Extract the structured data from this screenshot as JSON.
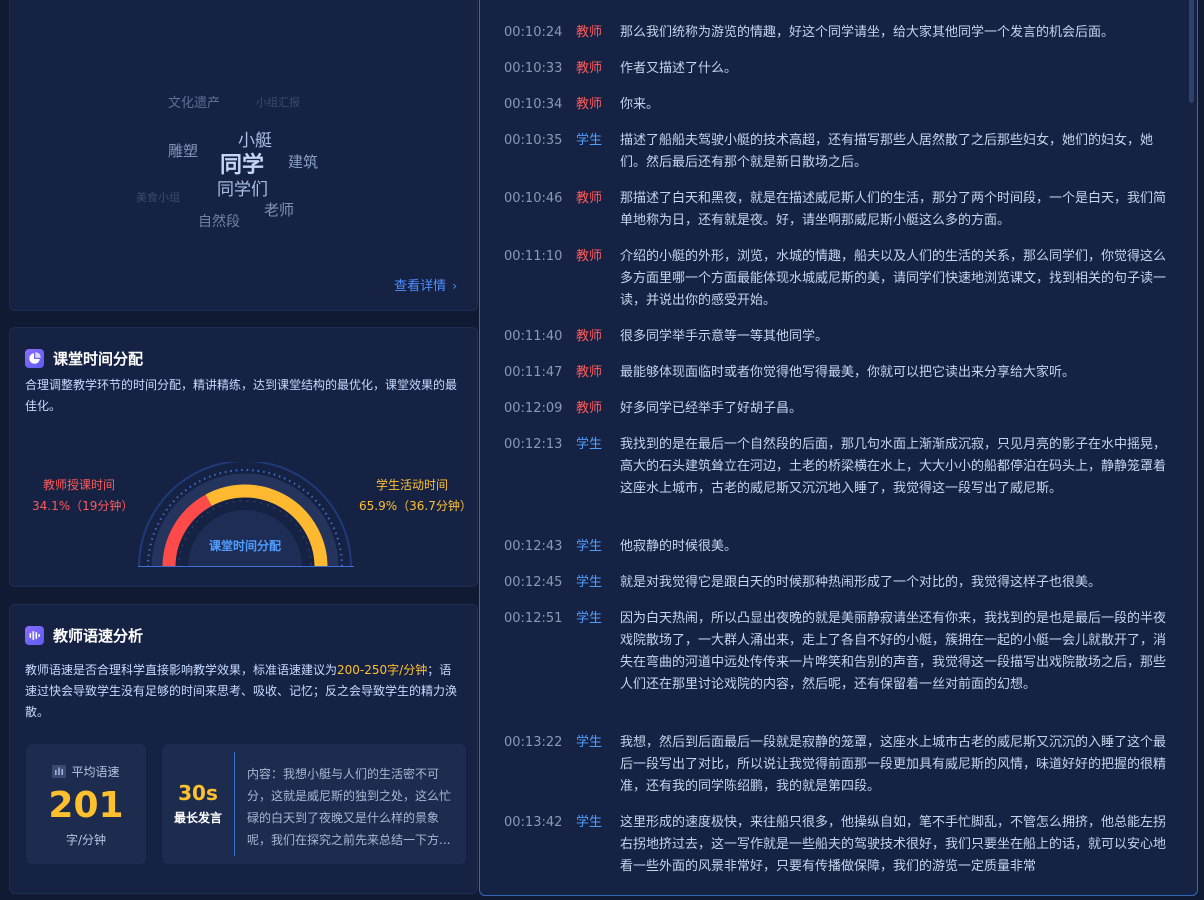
{
  "wordcloud": {
    "words": [
      {
        "text": "文化遗产",
        "color": "#5d6f94",
        "size": 13
      },
      {
        "text": "小组汇报",
        "color": "#3a4a6d",
        "size": 11
      },
      {
        "text": "小艇",
        "color": "#a9bde4",
        "size": 17
      },
      {
        "text": "雕塑",
        "color": "#8093b8",
        "size": 15
      },
      {
        "text": "同学",
        "color": "#c4d5f7",
        "size": 22
      },
      {
        "text": "建筑",
        "color": "#8a9dc2",
        "size": 15
      },
      {
        "text": "美食小组",
        "color": "#3a4a6d",
        "size": 11
      },
      {
        "text": "同学们",
        "color": "#a9bde4",
        "size": 17
      },
      {
        "text": "老师",
        "color": "#7f92b7",
        "size": 15
      },
      {
        "text": "自然段",
        "color": "#6f82a6",
        "size": 14
      }
    ],
    "detail_link": "查看详情",
    "detail_icon": "chevron-right-icon"
  },
  "time_distribution": {
    "title": "课堂时间分配",
    "icon": "pie-chart-icon",
    "description": "合理调整教学环节的时间分配，精讲精练，达到课堂结构的最优化，课堂效果的最佳化。",
    "teacher_label": "教师授课时间",
    "teacher_value": "34.1%（19分钟）",
    "student_label": "学生活动时间",
    "student_value": "65.9%（36.7分钟）",
    "center_label": "课堂时间分配",
    "teacher_fraction": 0.341,
    "colors": {
      "teacher": "#ff4a4a",
      "student": "#ffb930"
    }
  },
  "speech_speed": {
    "title": "教师语速分析",
    "icon": "audio-wave-icon",
    "desc_before": "教师语速是否合理科学直接影响教学效果，标准语速建议为",
    "desc_highlight": "200-250字/分钟",
    "desc_after": "；语速过快会导致学生没有足够的时间来思考、吸收、记忆；反之会导致学生的精力涣散。",
    "avg_label": "平均语速",
    "avg_value": "201",
    "avg_unit": "字/分钟",
    "longest_seconds": "30s",
    "longest_label": "最长发言",
    "longest_content": "内容：我想小艇与人们的生活密不可分，这就是威尼斯的独到之处，这么忙碌的白天到了夜晚又是什么样的景象呢，我们在探究之前先来总结一下方..."
  },
  "transcript": [
    {
      "time": "00:10:24",
      "role": "教师",
      "type": "teacher",
      "text": "那么我们统称为游览的情趣，好这个同学请坐，给大家其他同学一个发言的机会后面。"
    },
    {
      "time": "00:10:33",
      "role": "教师",
      "type": "teacher",
      "text": "作者又描述了什么。"
    },
    {
      "time": "00:10:34",
      "role": "教师",
      "type": "teacher",
      "text": "你来。"
    },
    {
      "time": "00:10:35",
      "role": "学生",
      "type": "student",
      "text": "描述了船船夫驾驶小艇的技术高超，还有描写那些人居然散了之后那些妇女，她们的妇女，她们。然后最后还有那个就是新日散场之后。"
    },
    {
      "time": "00:10:46",
      "role": "教师",
      "type": "teacher",
      "text": "那描述了白天和黑夜，就是在描述威尼斯人们的生活，那分了两个时间段，一个是白天，我们简单地称为日，还有就是夜。好，请坐啊那威尼斯小艇这么多的方面。"
    },
    {
      "time": "00:11:10",
      "role": "教师",
      "type": "teacher",
      "text": "介绍的小艇的外形，浏览，水城的情趣，船夫以及人们的生活的关系，那么同学们，你觉得这么多方面里哪一个方面最能体现水城威尼斯的美，请同学们快速地浏览课文，找到相关的句子读一读，并说出你的感受开始。"
    },
    {
      "time": "00:11:40",
      "role": "教师",
      "type": "teacher",
      "text": "很多同学举手示意等一等其他同学。"
    },
    {
      "time": "00:11:47",
      "role": "教师",
      "type": "teacher",
      "text": "最能够体现面临时或者你觉得他写得最美，你就可以把它读出来分享给大家听。"
    },
    {
      "time": "00:12:09",
      "role": "教师",
      "type": "teacher",
      "text": "好多同学已经举手了好胡子昌。"
    },
    {
      "time": "00:12:13",
      "role": "学生",
      "type": "student",
      "text": "我找到的是在最后一个自然段的后面，那几句水面上渐渐成沉寂，只见月亮的影子在水中摇晃，高大的石头建筑耸立在河边，土老的桥梁横在水上，大大小小的船都停泊在码头上，静静笼罩着这座水上城市，古老的威尼斯又沉沉地入睡了，我觉得这一段写出了威尼斯。"
    },
    {
      "time": "00:12:43",
      "role": "学生",
      "type": "student",
      "text": "他寂静的时候很美。"
    },
    {
      "time": "00:12:45",
      "role": "学生",
      "type": "student",
      "text": "就是对我觉得它是跟白天的时候那种热闹形成了一个对比的，我觉得这样子也很美。"
    },
    {
      "time": "00:12:51",
      "role": "学生",
      "type": "student",
      "text": "因为白天热闹，所以凸显出夜晚的就是美丽静寂请坐还有你来，我找到的是也是最后一段的半夜戏院散场了，一大群人涌出来，走上了各自不好的小艇，簇拥在一起的小艇一会儿就散开了，消失在弯曲的河道中远处传传来一片哗笑和告别的声音，我觉得这一段描写出戏院散场之后，那些人们还在那里讨论戏院的内容，然后呢，还有保留着一丝对前面的幻想。"
    },
    {
      "time": "00:13:22",
      "role": "学生",
      "type": "student",
      "text": "我想，然后到后面最后一段就是寂静的笼罩，这座水上城市古老的威尼斯又沉沉的入睡了这个最后一段写出了对比，所以说让我觉得前面那一段更加具有威尼斯的风情，味道好好的把握的很精准，还有我的同学陈绍鹏，我的就是第四段。"
    },
    {
      "time": "00:13:42",
      "role": "学生",
      "type": "student",
      "text": "这里形成的速度极快，来往船只很多，他操纵自如，笔不手忙脚乱，不管怎么拥挤，他总能左拐右拐地挤过去，这一写作就是一些船夫的驾驶技术很好，我们只要坐在船上的话，就可以安心地看一些外面的风景非常好，只要有传播做保障，我们的游览一定质量非常"
    }
  ]
}
